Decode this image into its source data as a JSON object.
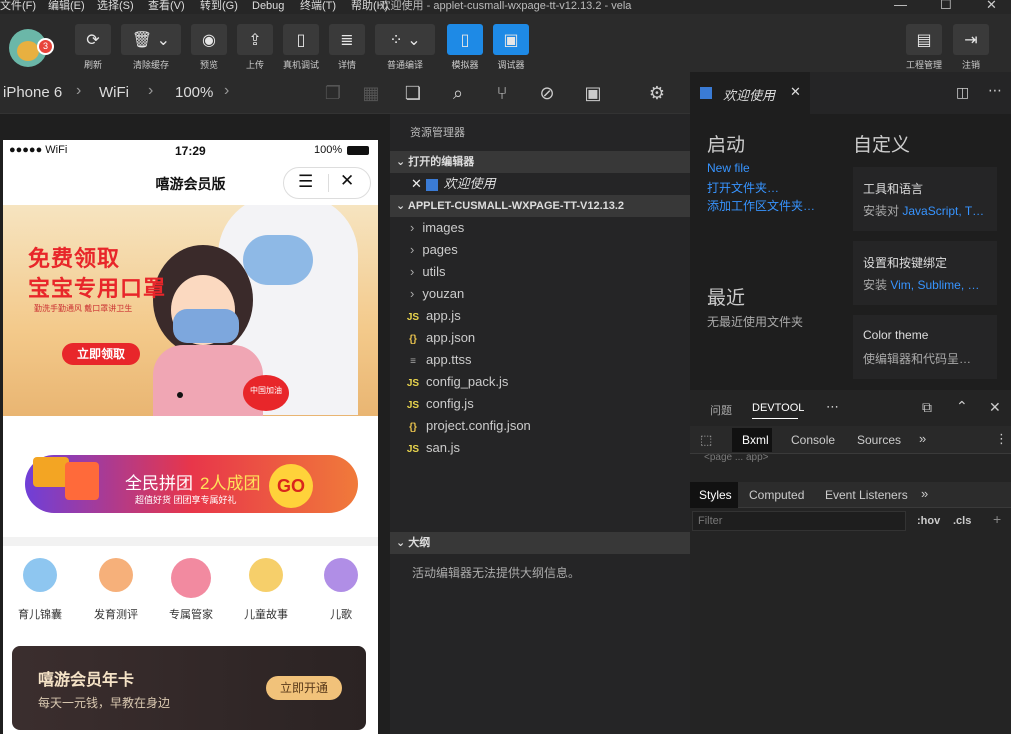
{
  "menubar": {
    "items": [
      "文件(F)",
      "编辑(E)",
      "选择(S)",
      "查看(V)",
      "转到(G)",
      "Debug",
      "终端(T)",
      "帮助(H)"
    ],
    "title": "欢迎使用 - applet-cusmall-wxpage-tt-v12.13.2 - vela"
  },
  "toolbar": {
    "badge": "3",
    "buttons": [
      "刷新",
      "清除缓存",
      "预览",
      "上传",
      "真机调试",
      "详情",
      "普通编译",
      "模拟器",
      "调试器"
    ],
    "right": [
      "工程管理",
      "注销"
    ]
  },
  "devbar": {
    "device": "iPhone 6",
    "network": "WiFi",
    "zoom": "100%"
  },
  "phone": {
    "carrier": "●●●●● WiFi",
    "time": "17:29",
    "battery": "100%",
    "title": "嘻游会员版",
    "banner": {
      "line1": "免费领取",
      "line2": "宝宝专用口罩",
      "small": "勤洗手勤通风 戴口罩讲卫生",
      "button": "立即领取",
      "heart": "中国加油"
    },
    "pin": {
      "text1": "全民拼团",
      "text2": "2人成团",
      "go": "GO",
      "sub": "超值好货 团团享专属好礼"
    },
    "icons": [
      "育儿锦囊",
      "发育测评",
      "专属管家",
      "儿童故事",
      "儿歌"
    ],
    "card": {
      "title": "嘻游会员年卡",
      "sub": "每天一元钱，早教在身边",
      "btn": "立即开通"
    }
  },
  "explorer": {
    "header": "资源管理器",
    "open_section": "打开的编辑器",
    "open_item": "欢迎使用",
    "project": "APPLET-CUSMALL-WXPAGE-TT-V12.13.2",
    "folders": [
      "images",
      "pages",
      "utils",
      "youzan"
    ],
    "files": [
      {
        "name": "app.js",
        "icon": "JS",
        "color": "#e8d44d"
      },
      {
        "name": "app.json",
        "icon": "{}",
        "color": "#e8c24d"
      },
      {
        "name": "app.ttss",
        "icon": "≡",
        "color": "#aaa"
      },
      {
        "name": "config_pack.js",
        "icon": "JS",
        "color": "#e8d44d"
      },
      {
        "name": "config.js",
        "icon": "JS",
        "color": "#e8d44d"
      },
      {
        "name": "project.config.json",
        "icon": "{}",
        "color": "#e8c24d"
      },
      {
        "name": "san.js",
        "icon": "JS",
        "color": "#e8d44d"
      }
    ],
    "outline": "大纲",
    "outline_msg": "活动编辑器无法提供大纲信息。"
  },
  "editor": {
    "tab": "欢迎使用",
    "start": "启动",
    "links": [
      "New file",
      "打开文件夹…",
      "添加工作区文件夹…"
    ],
    "recent": "最近",
    "recent_msg": "无最近使用文件夹",
    "custom": "自定义",
    "cards": [
      {
        "title": "工具和语言",
        "pre": "安装对 ",
        "hl": "JavaScript, T…",
        "post": ""
      },
      {
        "title": "设置和按键绑定",
        "pre": "安装 ",
        "hl": "Vim, Sublime, …",
        "post": ""
      },
      {
        "title": "Color theme",
        "pre": "使编辑器和代码呈…",
        "hl": "",
        "post": ""
      }
    ]
  },
  "devtool": {
    "tabs": [
      "问题",
      "DEVTOOL"
    ],
    "subtabs": [
      "Bxml",
      "Console",
      "Sources"
    ],
    "code": "<page ... app>",
    "styles_tabs": [
      "Styles",
      "Computed",
      "Event Listeners"
    ],
    "filter": "Filter",
    "hov": ":hov",
    ".cls": ".cls"
  }
}
